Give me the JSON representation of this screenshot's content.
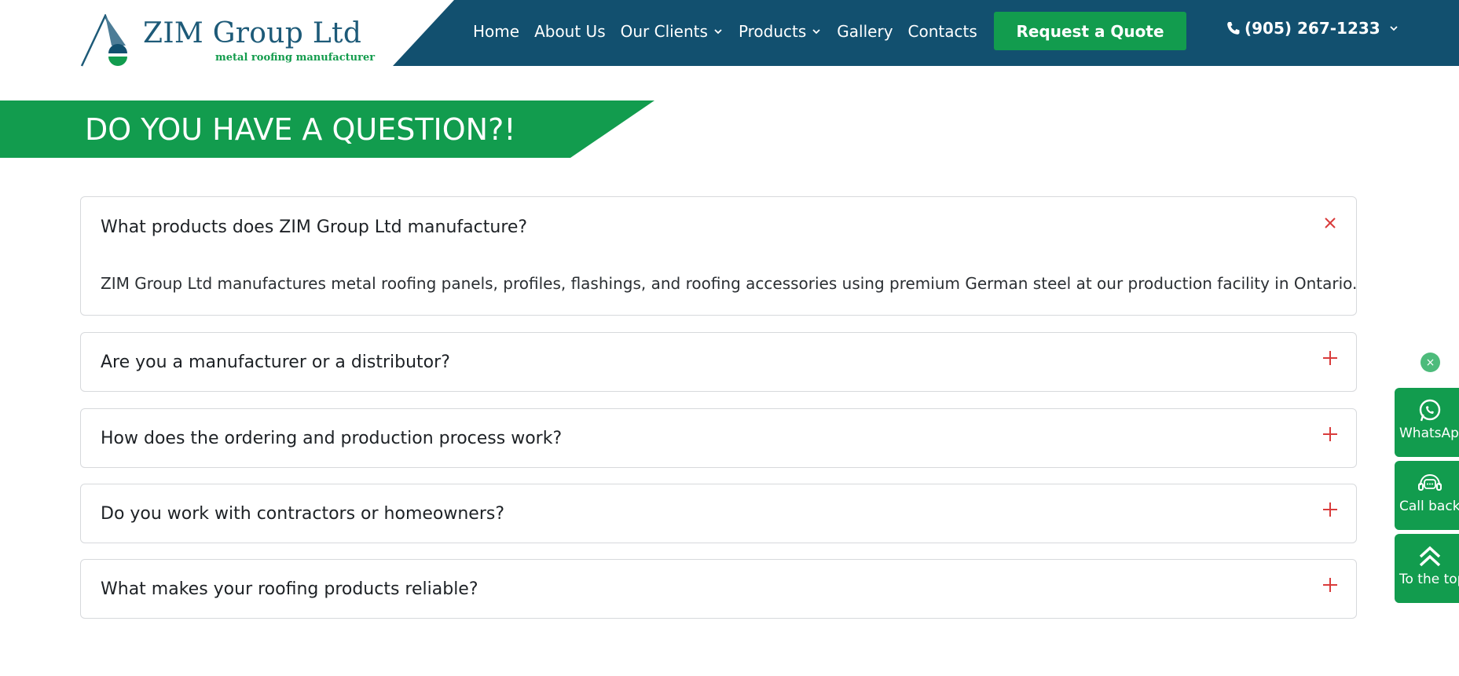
{
  "brand": {
    "name": "ZIM Group Ltd",
    "tagline": "metal roofing manufacturer"
  },
  "nav": {
    "items": [
      {
        "label": "Home",
        "dropdown": false
      },
      {
        "label": "About Us",
        "dropdown": false
      },
      {
        "label": "Our Clients",
        "dropdown": true
      },
      {
        "label": "Products",
        "dropdown": true
      },
      {
        "label": "Gallery",
        "dropdown": false
      },
      {
        "label": "Contacts",
        "dropdown": false
      }
    ],
    "quote_button": "Request a Quote",
    "phone": "(905) 267-1233"
  },
  "banner": {
    "title": "DO YOU HAVE A QUESTION?!"
  },
  "faq": [
    {
      "question": "What products does ZIM Group Ltd manufacture?",
      "answer": "ZIM Group Ltd manufactures metal roofing panels, profiles, flashings, and roofing accessories using premium German steel at our production facility in Ontario.",
      "expanded": true
    },
    {
      "question": "Are you a manufacturer or a distributor?",
      "expanded": false
    },
    {
      "question": "How does the ordering and production process work?",
      "expanded": false
    },
    {
      "question": "Do you work with contractors or homeowners?",
      "expanded": false
    },
    {
      "question": "What makes your roofing products reliable?",
      "expanded": false
    }
  ],
  "side_widget": {
    "close": "×",
    "whatsapp": "WhatsApp",
    "callback": "Call back",
    "top": "To the top"
  },
  "colors": {
    "header_blue": "#12506f",
    "brand_green": "#129c4e",
    "icon_red": "#d93c3c"
  }
}
